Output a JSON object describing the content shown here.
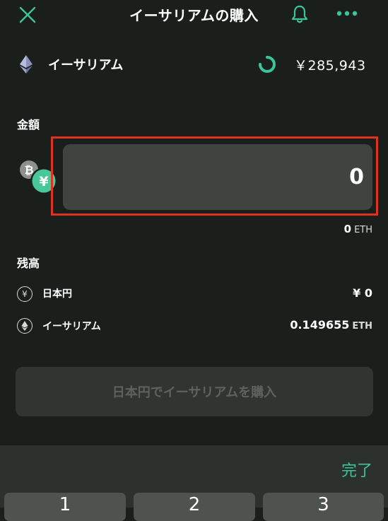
{
  "colors": {
    "background": "#1a1f1c",
    "accent": "#3dc49a",
    "highlight_border": "#e0331f",
    "field_bg": "#3f4440",
    "button_disabled_bg": "#313531",
    "button_disabled_text": "#5d625e"
  },
  "header": {
    "title": "イーサリアムの購入",
    "icons": [
      "close-icon",
      "bell-icon",
      "more-icon"
    ]
  },
  "asset": {
    "name": "イーサリアム",
    "price": "￥285,943",
    "icons": [
      "ethereum-icon",
      "refresh-spinner-icon"
    ]
  },
  "amount": {
    "label": "金額",
    "value": "0",
    "eth_value": "0",
    "eth_unit": "ETH",
    "icons": [
      "bitcoin-coin-icon",
      "yen-coin-icon"
    ]
  },
  "balance": {
    "label": "残高",
    "yen": {
      "icon_glyph": "¥",
      "name": "日本円",
      "value": "¥ 0"
    },
    "eth": {
      "icon_glyph": "⟠",
      "name": "イーサリアム",
      "value": "0.149655",
      "unit": "ETH"
    }
  },
  "buy_button": {
    "label": "日本円でイーサリアムを購入",
    "disabled": true
  },
  "keyboard": {
    "done_label": "完了",
    "keys": [
      "1",
      "2",
      "3"
    ]
  }
}
